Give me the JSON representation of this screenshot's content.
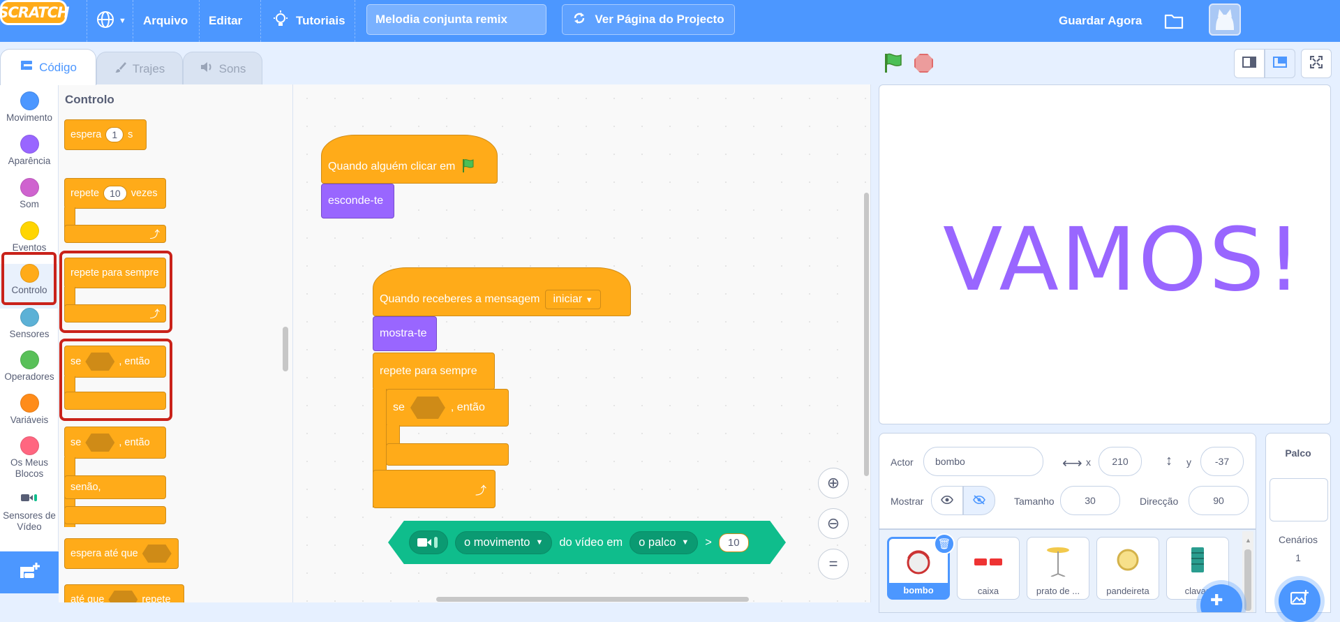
{
  "menu": {
    "logo": "SCRATCH",
    "file": "Arquivo",
    "edit": "Editar",
    "tutorials": "Tutoriais",
    "project_title": "Melodia conjunta remix",
    "see_project_page": "Ver Página do Projecto",
    "save_now": "Guardar Agora"
  },
  "tabs": {
    "code": "Código",
    "costumes": "Trajes",
    "sounds": "Sons"
  },
  "categories": [
    {
      "label": "Movimento",
      "color": "#4c97ff"
    },
    {
      "label": "Aparência",
      "color": "#9966ff"
    },
    {
      "label": "Som",
      "color": "#cf63cf"
    },
    {
      "label": "Eventos",
      "color": "#ffd500"
    },
    {
      "label": "Controlo",
      "color": "#ffab19"
    },
    {
      "label": "Sensores",
      "color": "#5cb1d6"
    },
    {
      "label": "Operadores",
      "color": "#59c059"
    },
    {
      "label": "Variáveis",
      "color": "#ff8c1a"
    },
    {
      "label": "Os Meus Blocos",
      "color": "#ff6680"
    },
    {
      "label": "Sensores de Vídeo",
      "color": "#0fbd8c"
    }
  ],
  "palette": {
    "title": "Controlo",
    "wait": {
      "label": "espera",
      "value": "1",
      "unit": "s"
    },
    "repeat": {
      "label": "repete",
      "value": "10",
      "unit": "vezes"
    },
    "forever": "repete para sempre",
    "if_then": {
      "if": "se",
      "then": ", então"
    },
    "if_else": {
      "if": "se",
      "then": ", então",
      "else": "senão,"
    },
    "wait_until": "espera até que",
    "repeat_until": {
      "label": "até que",
      "suffix": "repete"
    }
  },
  "scripts": {
    "when_flag": "Quando alguém clicar em",
    "hide": "esconde-te",
    "when_receive": "Quando receberes a mensagem",
    "message": "iniciar",
    "show": "mostra-te",
    "forever": "repete para sempre",
    "if": "se",
    "then": ", então",
    "video": {
      "motion": "o movimento",
      "mid": "do vídeo em",
      "target": "o palco",
      "op": ">",
      "value": "10"
    }
  },
  "stage": {
    "text": "VAMOS!"
  },
  "sprite_info": {
    "actor_label": "Actor",
    "actor_name": "bombo",
    "x_label": "x",
    "x": "210",
    "y_label": "y",
    "y": "-37",
    "show_label": "Mostrar",
    "size_label": "Tamanho",
    "size": "30",
    "direction_label": "Direcção",
    "direction": "90"
  },
  "sprites": [
    "bombo",
    "caixa",
    "prato de ...",
    "pandeireta",
    "clavas"
  ],
  "stage_pane": {
    "title": "Palco",
    "backdrops_label": "Cenários",
    "backdrops": "1"
  },
  "colors": {
    "accent": "#4c97ff",
    "control": "#ffab19",
    "looks": "#9966ff",
    "video": "#0fbd8c",
    "highlight": "#c9221a"
  }
}
